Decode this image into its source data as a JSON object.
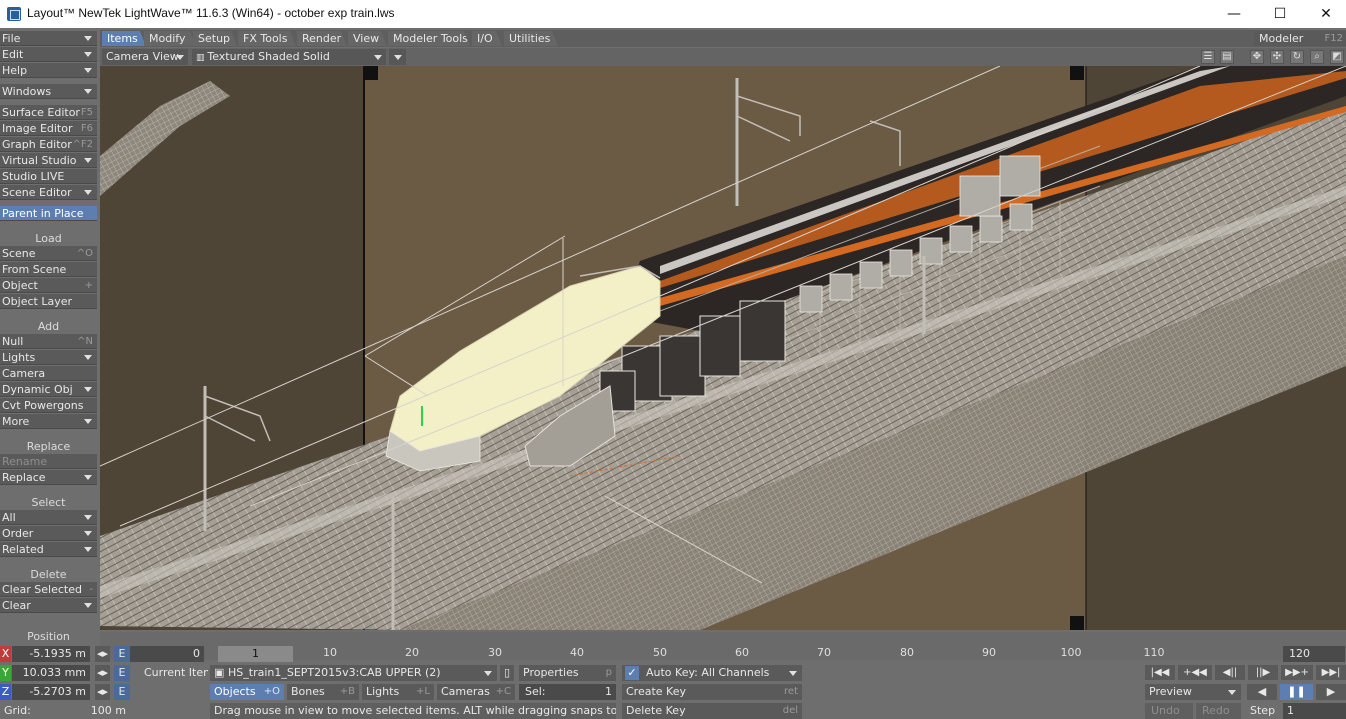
{
  "titlebar": {
    "title": "Layout™ NewTek LightWave™ 11.6.3 (Win64) - october exp train.lws",
    "minimize": "—",
    "maximize": "☐",
    "close": "✕"
  },
  "menu": {
    "file": "File",
    "edit": "Edit",
    "help": "Help",
    "windows": "Windows",
    "surface_editor": "Surface Editor",
    "surface_editor_sc": "F5",
    "image_editor": "Image Editor",
    "image_editor_sc": "F6",
    "graph_editor": "Graph Editor",
    "graph_editor_sc": "^F2",
    "virtual_studio": "Virtual Studio",
    "studio_live": "Studio LIVE",
    "scene_editor": "Scene Editor",
    "parent_in_place": "Parent in Place",
    "load_header": "Load",
    "scene": "Scene",
    "scene_sc": "^O",
    "from_scene": "From Scene",
    "object": "Object",
    "object_sc": "+",
    "object_layer": "Object Layer",
    "add_header": "Add",
    "null": "Null",
    "null_sc": "^N",
    "lights": "Lights",
    "camera": "Camera",
    "dynamic_obj": "Dynamic Obj",
    "cvt_powergons": "Cvt Powergons",
    "more": "More",
    "replace_header": "Replace",
    "rename": "Rename",
    "replace": "Replace",
    "select_header": "Select",
    "all": "All",
    "order": "Order",
    "related": "Related",
    "delete_header": "Delete",
    "clear_selected": "Clear Selected",
    "clear_selected_sc": "-",
    "clear": "Clear",
    "position_header": "Position"
  },
  "tabs": [
    "Items",
    "Modify",
    "Setup",
    "FX Tools",
    "Render",
    "View",
    "Modeler Tools",
    "I/O",
    "Utilities"
  ],
  "modeler": {
    "label": "Modeler",
    "shortcut": "F12"
  },
  "viewport": {
    "view_mode": "Camera View",
    "render_mode": "Textured Shaded Solid Wireframe"
  },
  "position": {
    "x": "-5.1935 m",
    "y": "10.033 mm",
    "z": "-5.2703 m",
    "x_label": "X",
    "y_label": "Y",
    "z_label": "Z",
    "env_label": "E"
  },
  "grid": {
    "label": "Grid:",
    "value": "100 m"
  },
  "timeline": {
    "start": "0",
    "current": "1",
    "end": "120",
    "ticks": [
      "10",
      "20",
      "30",
      "40",
      "50",
      "60",
      "70",
      "80",
      "90",
      "100",
      "110"
    ]
  },
  "current_item": {
    "label": "Current Item",
    "value": "HS_train1_SEPT2015v3:CAB UPPER (2)"
  },
  "properties": {
    "label": "Properties",
    "shortcut": "p"
  },
  "item_types": {
    "objects": "Objects",
    "objects_sc": "+O",
    "bones": "Bones",
    "bones_sc": "+B",
    "lights": "Lights",
    "lights_sc": "+L",
    "cameras": "Cameras",
    "cameras_sc": "+C"
  },
  "sel": {
    "label": "Sel:",
    "value": "1"
  },
  "status": "Drag mouse in view to move selected items. ALT while dragging snaps to items.",
  "keys": {
    "auto_key": "Auto Key: All Channels",
    "create_key": "Create Key",
    "create_key_sc": "ret",
    "delete_key": "Delete Key",
    "delete_key_sc": "del"
  },
  "playback": {
    "preview": "Preview",
    "undo": "Undo",
    "redo": "Redo",
    "step_label": "Step",
    "step_value": "1"
  },
  "colors": {
    "accent": "#5c7eb0",
    "panel": "#6e6e6e",
    "button": "#5a5a5a",
    "viewport_bg": "#6b5a44"
  }
}
